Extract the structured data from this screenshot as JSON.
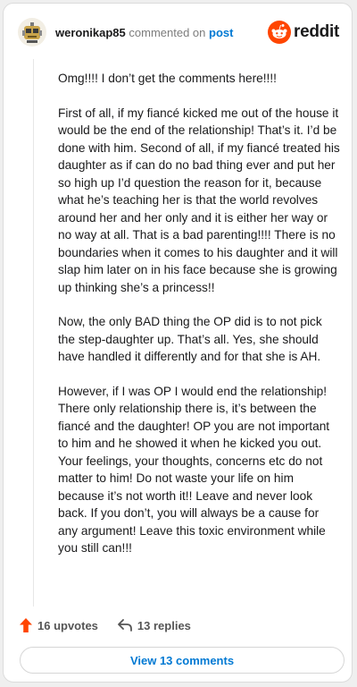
{
  "header": {
    "username": "weronikap85",
    "action_text": "commented on",
    "post_link": "post",
    "brand": "reddit"
  },
  "colors": {
    "accent": "#0079d3",
    "upvote": "#ff4500",
    "text": "#1a1a1b"
  },
  "comment": {
    "paragraphs": [
      "Omg!!!! I don’t get the comments here!!!!",
      "First of all, if my fiancé kicked me out of the house it would be the end of the relationship! That’s it. I’d be done with him. Second of all, if my fiancé treated his daughter as if can do no bad thing ever and put her so high up I’d question the reason for it, because what he’s teaching her is that the world revolves around her and her only and it is either her way or no way at all. That is a bad parenting!!!! There is no boundaries when it comes to his daughter and it will slap him later on in his face because she is growing up thinking she’s a princess!!",
      "Now, the only BAD thing the OP did is to not pick the step-daughter up. That’s all. Yes, she should have handled it differently and for that she is AH.",
      "However, if I was OP I would end the relationship! There only relationship there is, it’s between the fiancé and the daughter! OP you are not important to him and he showed it when he kicked you out. Your feelings, your thoughts, concerns etc do not matter to him! Do not waste your life on him because it’s not worth it!! Leave and never look back. If you don’t, you will always be a cause for any argument! Leave this toxic environment while you still can!!!"
    ]
  },
  "actions": {
    "upvotes_label": "16 upvotes",
    "replies_label": "13 replies"
  },
  "footer": {
    "view_button": "View 13 comments"
  },
  "icons": {
    "avatar": "snoo-avatar-icon",
    "brand": "reddit-logo-icon",
    "upvote": "upvote-arrow-icon",
    "reply": "reply-arrow-icon"
  }
}
